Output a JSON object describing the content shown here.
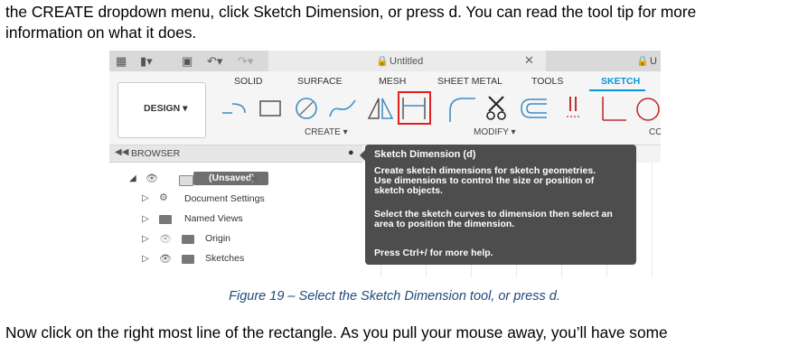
{
  "doc": {
    "line1": "the CREATE dropdown menu, click Sketch Dimension, or press d. You can read the tool tip for more",
    "line2": "information on what it does.",
    "caption": "Figure 19 – Select the Sketch Dimension tool, or press d.",
    "line3": "Now click on the right most line of the rectangle. As you pull your mouse away, you’ll have some"
  },
  "app": {
    "document_title": "Untitled",
    "user_initial": "U",
    "tabs": [
      "SOLID",
      "SURFACE",
      "MESH",
      "SHEET METAL",
      "TOOLS",
      "SKETCH"
    ],
    "active_tab": "SKETCH",
    "workspace": "DESIGN ▾",
    "groups": {
      "create": "CREATE ▾",
      "modify": "MODIFY ▾",
      "co": "CO"
    },
    "accent": "#0696d7",
    "highlight_color": "#e02020"
  },
  "browser": {
    "title": "BROWSER",
    "root": "(Unsaved)",
    "items": [
      "Document Settings",
      "Named Views",
      "Origin",
      "Sketches"
    ]
  },
  "tooltip": {
    "title": "Sketch Dimension (d)",
    "lines_a": [
      "Create sketch dimensions for sketch geometries.",
      "Use dimensions to control the size or position of",
      "sketch objects."
    ],
    "lines_b": [
      "Select the sketch curves to dimension then select an",
      "area to position the dimension."
    ],
    "help": "Press Ctrl+/ for more help."
  }
}
